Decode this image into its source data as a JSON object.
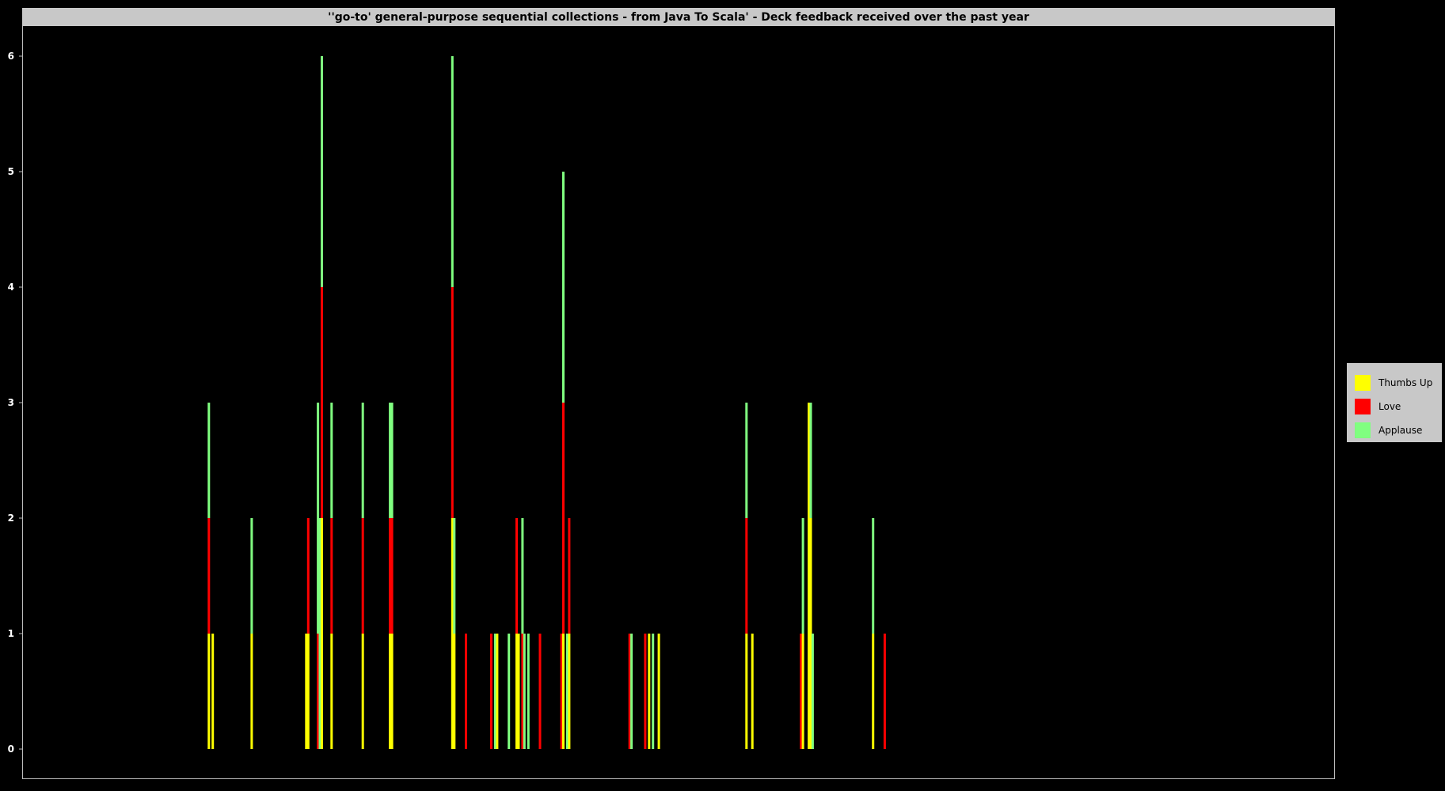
{
  "chart_data": {
    "type": "bar",
    "stacked": true,
    "title": "''go-to' general-purpose sequential collections - from Java To Scala' - Deck feedback received over the past year",
    "xlabel": "",
    "ylabel": "",
    "ylim": [
      0,
      6.3
    ],
    "yticks": [
      0,
      1,
      2,
      3,
      4,
      5,
      6
    ],
    "grid": false,
    "legend_position": "right",
    "legend": [
      {
        "name": "Thumbs Up",
        "color": "#ffff00"
      },
      {
        "name": "Love",
        "color": "#ff0000"
      },
      {
        "name": "Applause",
        "color": "#80ff80"
      }
    ],
    "day_range": [
      0,
      365
    ],
    "days": [
      42,
      44,
      64,
      92,
      93,
      98,
      99,
      100,
      105,
      121,
      135,
      136,
      167,
      168,
      174,
      187,
      189,
      190,
      196,
      200,
      201,
      203,
      204,
      206,
      212,
      223,
      224,
      226,
      227,
      258,
      259,
      266,
      268,
      270,
      273,
      318,
      321,
      346,
      347,
      350,
      351,
      352,
      383,
      389
    ],
    "series": [
      {
        "name": "Thumbs Up",
        "values": [
          1,
          1,
          1,
          1,
          1,
          0,
          0,
          2,
          1,
          1,
          1,
          1,
          2,
          1,
          0,
          0,
          0,
          1,
          0,
          1,
          1,
          0,
          0,
          0,
          0,
          0,
          1,
          0,
          1,
          0,
          0,
          0,
          1,
          0,
          1,
          1,
          1,
          0,
          1,
          3,
          2,
          0,
          1,
          0
        ]
      },
      {
        "name": "Love",
        "values": [
          1,
          0,
          0,
          0,
          1,
          1,
          0,
          2,
          1,
          1,
          1,
          1,
          2,
          0,
          1,
          1,
          0,
          0,
          0,
          1,
          0,
          1,
          0,
          0,
          1,
          1,
          2,
          0,
          1,
          1,
          0,
          1,
          0,
          0,
          0,
          1,
          0,
          1,
          0,
          0,
          0,
          0,
          0,
          1
        ]
      },
      {
        "name": "Applause",
        "values": [
          1,
          0,
          1,
          0,
          0,
          2,
          2,
          2,
          1,
          1,
          1,
          1,
          2,
          1,
          0,
          0,
          1,
          0,
          1,
          0,
          0,
          1,
          1,
          1,
          0,
          0,
          2,
          1,
          0,
          0,
          1,
          0,
          0,
          1,
          0,
          1,
          0,
          0,
          1,
          0,
          1,
          1,
          1,
          0
        ]
      }
    ]
  }
}
